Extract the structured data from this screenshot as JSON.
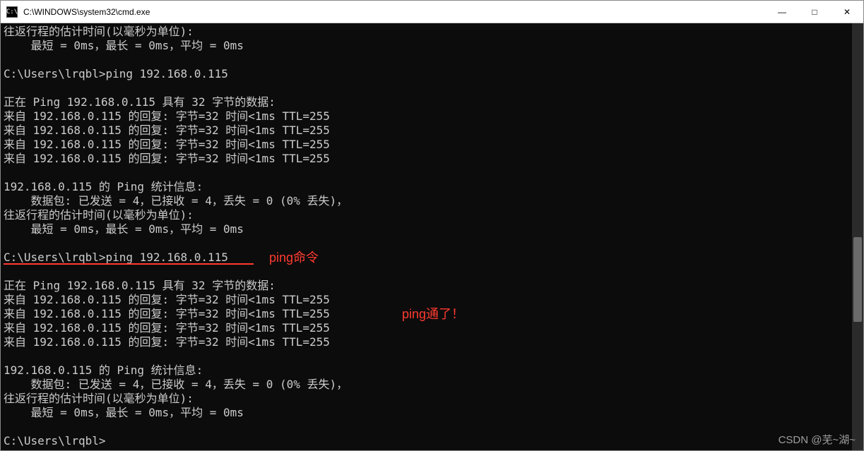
{
  "window": {
    "icon_text": "C:\\",
    "title": "C:\\WINDOWS\\system32\\cmd.exe",
    "controls": {
      "minimize": "—",
      "maximize": "□",
      "close": "✕"
    }
  },
  "terminal": {
    "lines": [
      "往返行程的估计时间(以毫秒为单位):",
      "    最短 = 0ms，最长 = 0ms，平均 = 0ms",
      "",
      "C:\\Users\\lrqbl>ping 192.168.0.115",
      "",
      "正在 Ping 192.168.0.115 具有 32 字节的数据:",
      "来自 192.168.0.115 的回复: 字节=32 时间<1ms TTL=255",
      "来自 192.168.0.115 的回复: 字节=32 时间<1ms TTL=255",
      "来自 192.168.0.115 的回复: 字节=32 时间<1ms TTL=255",
      "来自 192.168.0.115 的回复: 字节=32 时间<1ms TTL=255",
      "",
      "192.168.0.115 的 Ping 统计信息:",
      "    数据包: 已发送 = 4，已接收 = 4，丢失 = 0 (0% 丢失)，",
      "往返行程的估计时间(以毫秒为单位):",
      "    最短 = 0ms，最长 = 0ms，平均 = 0ms",
      "",
      "C:\\Users\\lrqbl>ping 192.168.0.115",
      "",
      "正在 Ping 192.168.0.115 具有 32 字节的数据:",
      "来自 192.168.0.115 的回复: 字节=32 时间<1ms TTL=255",
      "来自 192.168.0.115 的回复: 字节=32 时间<1ms TTL=255",
      "来自 192.168.0.115 的回复: 字节=32 时间<1ms TTL=255",
      "来自 192.168.0.115 的回复: 字节=32 时间<1ms TTL=255",
      "",
      "192.168.0.115 的 Ping 统计信息:",
      "    数据包: 已发送 = 4，已接收 = 4，丢失 = 0 (0% 丢失)，",
      "往返行程的估计时间(以毫秒为单位):",
      "    最短 = 0ms，最长 = 0ms，平均 = 0ms",
      "",
      "C:\\Users\\lrqbl>"
    ]
  },
  "annotations": {
    "ping_cmd_label": "ping命令",
    "ping_success_label": "ping通了！"
  },
  "watermark": "CSDN @芜~湖~"
}
